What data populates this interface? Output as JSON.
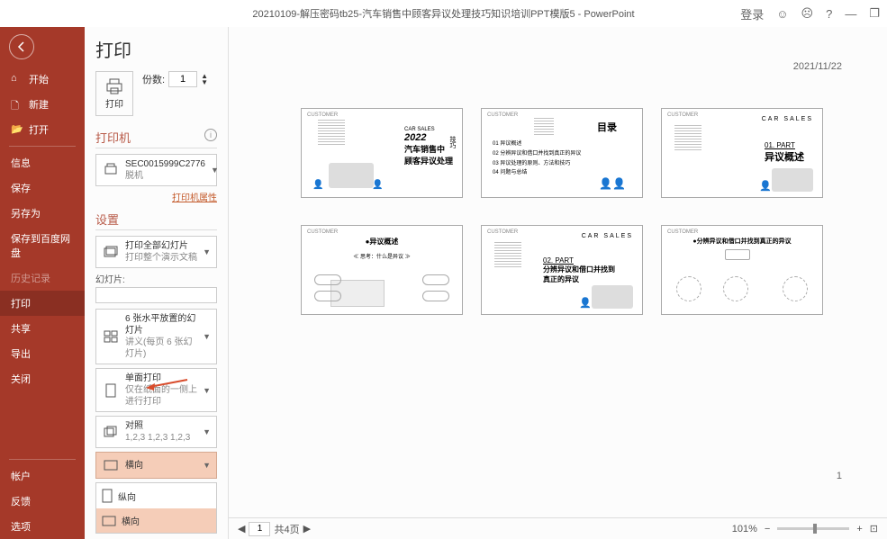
{
  "titlebar": {
    "title": "20210109-解压密码tb25-汽车销售中顾客异议处理技巧知识培训PPT模版5  -  PowerPoint",
    "login": "登录"
  },
  "sidebar": {
    "back": "←",
    "items": [
      {
        "label": "开始",
        "icon": "home"
      },
      {
        "label": "新建",
        "icon": "new"
      },
      {
        "label": "打开",
        "icon": "open"
      }
    ],
    "items2": [
      {
        "label": "信息"
      },
      {
        "label": "保存"
      },
      {
        "label": "另存为"
      },
      {
        "label": "保存到百度网盘"
      },
      {
        "label": "历史记录",
        "muted": true
      },
      {
        "label": "打印",
        "active": true
      },
      {
        "label": "共享"
      },
      {
        "label": "导出"
      },
      {
        "label": "关闭"
      }
    ],
    "bottom": [
      {
        "label": "帐户"
      },
      {
        "label": "反馈"
      },
      {
        "label": "选项"
      }
    ]
  },
  "print": {
    "title": "打印",
    "print_label": "打印",
    "copies_label": "份数:",
    "copies_value": "1",
    "printer_section": "打印机",
    "printer_name": "SEC0015999C2776",
    "printer_status": "脱机",
    "printer_props": "打印机属性",
    "settings_section": "设置",
    "full_slides": "打印全部幻灯片",
    "full_slides_sub": "打印整个演示文稿",
    "slide_label": "幻灯片:",
    "handout": "6 张水平放置的幻灯片",
    "handout_sub": "讲义(每页 6 张幻灯片)",
    "single_side": "单面打印",
    "single_side_sub": "仅在纸面的一侧上进行打印",
    "collate": "对照",
    "collate_sub": "1,2,3   1,2,3   1,2,3",
    "orientation_h": "横向",
    "orientation_v": "纵向"
  },
  "preview": {
    "date": "2021/11/22",
    "page_num": "1",
    "slides": [
      {
        "title": "2022",
        "sub": "汽车销售中",
        "sub2": "顾客异议处理",
        "tag": "技巧",
        "label": "CAR SALES"
      },
      {
        "title": "目录",
        "items": [
          "01 异议概述",
          "02 分辨异议和借口并找到真正的异议",
          "03 异议处理的原则、方法和技巧",
          "04 问题与总结"
        ]
      },
      {
        "title": "异议概述",
        "part": "01. PART",
        "label": "CAR SALES"
      },
      {
        "title": "异议概述",
        "sub": "思考：什么是异议"
      },
      {
        "title": "分辨异议和借口并找到真正的异议",
        "part": "02. PART",
        "label": "CAR SALES"
      },
      {
        "title": "分辨异议和借口并找到真正的异议"
      }
    ]
  },
  "status": {
    "page_input": "1",
    "page_total": "共4页",
    "zoom": "101%"
  }
}
